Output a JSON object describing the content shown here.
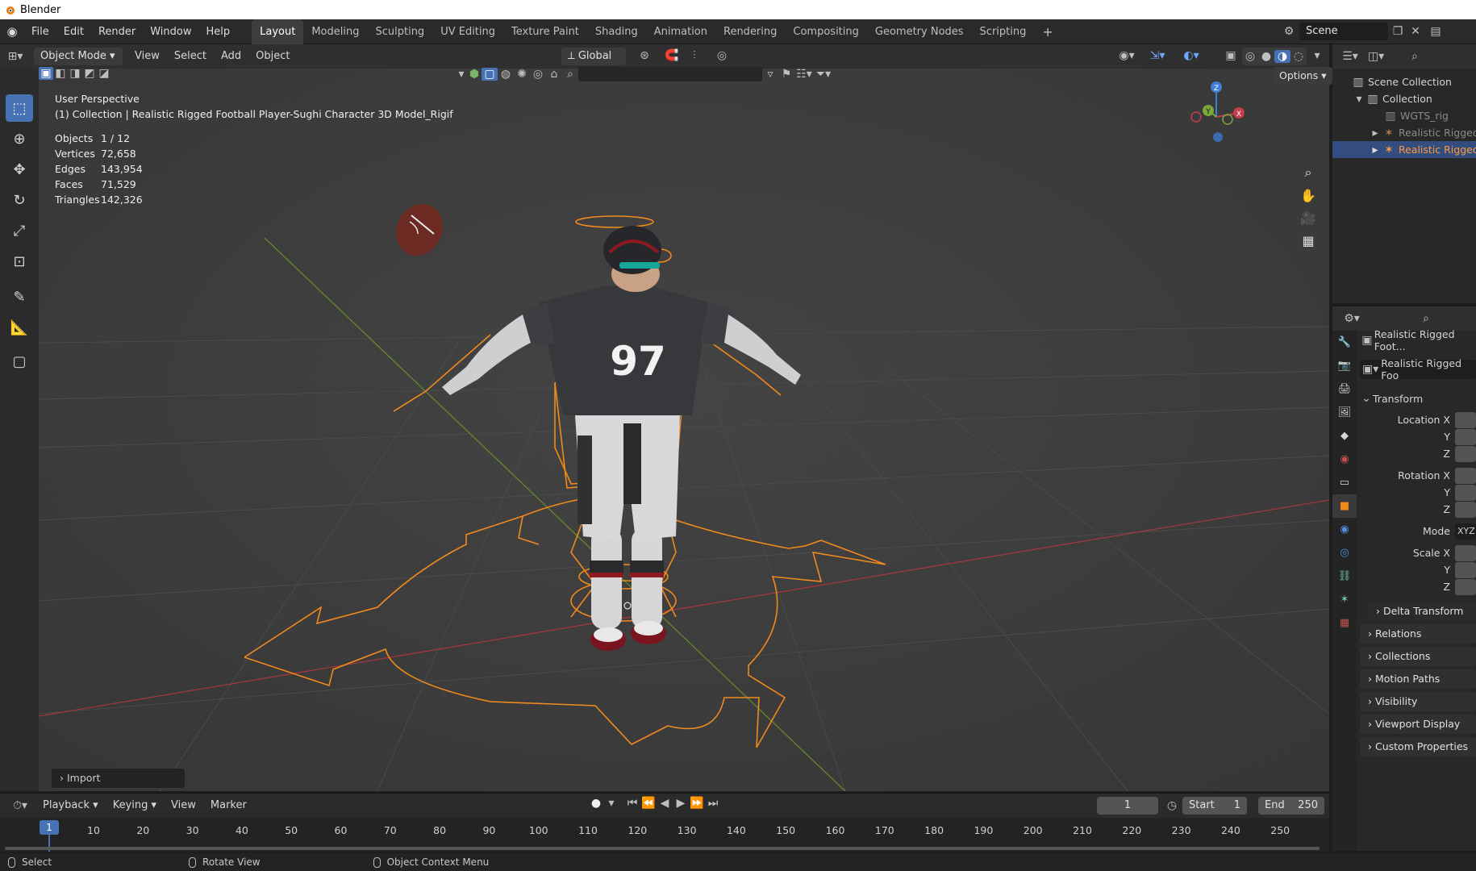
{
  "app": {
    "title": "Blender"
  },
  "topbar": {
    "menus": [
      "File",
      "Edit",
      "Render",
      "Window",
      "Help"
    ],
    "workspaces": [
      "Layout",
      "Modeling",
      "Sculpting",
      "UV Editing",
      "Texture Paint",
      "Shading",
      "Animation",
      "Rendering",
      "Compositing",
      "Geometry Nodes",
      "Scripting"
    ],
    "active_workspace": "Layout",
    "scene_name": "Scene",
    "add_tab_icon": "plus-icon"
  },
  "viewport_header": {
    "mode": "Object Mode",
    "menus": [
      "View",
      "Select",
      "Add",
      "Object"
    ],
    "orientation": "Global",
    "options_label": "Options"
  },
  "viewport": {
    "perspective": "User Perspective",
    "collection_line": "(1) Collection | Realistic Rigged Football Player-Sughi Character 3D Model_Rigif",
    "stats": [
      {
        "k": "Objects",
        "v": "1 / 12"
      },
      {
        "k": "Vertices",
        "v": "72,658"
      },
      {
        "k": "Edges",
        "v": "143,954"
      },
      {
        "k": "Faces",
        "v": "71,529"
      },
      {
        "k": "Triangles",
        "v": "142,326"
      }
    ],
    "jersey_number": "97",
    "import_panel": "Import",
    "gizmo": {
      "x": "X",
      "y": "Y",
      "z": "Z"
    }
  },
  "outliner": {
    "rows": [
      {
        "label": "Scene Collection",
        "indent": 0,
        "icon": "scene-collection-icon"
      },
      {
        "label": "Collection",
        "indent": 1,
        "icon": "collection-icon"
      },
      {
        "label": "WGTS_rig",
        "indent": 2,
        "icon": "collection-icon"
      },
      {
        "label": "Realistic Rigged F",
        "indent": 2,
        "icon": "armature-icon"
      },
      {
        "label": "Realistic Rigged F",
        "indent": 2,
        "icon": "armature-icon",
        "selected": true
      }
    ]
  },
  "properties": {
    "object_name": "Realistic Rigged Foot...",
    "data_name": "Realistic Rigged Foo",
    "transform_label": "Transform",
    "location_x": "Location X",
    "y": "Y",
    "z": "Z",
    "rotation_x": "Rotation X",
    "mode_label": "Mode",
    "mode_value": "XYZ",
    "scale_x": "Scale X",
    "sections": [
      "Delta Transform",
      "Relations",
      "Collections",
      "Motion Paths",
      "Visibility",
      "Viewport Display",
      "Custom Properties"
    ]
  },
  "timeline": {
    "menus": [
      "Playback",
      "Keying",
      "View",
      "Marker"
    ],
    "current_frame": "1",
    "start_label": "Start",
    "start_value": "1",
    "end_label": "End",
    "end_value": "250",
    "frame_labels": [
      "10",
      "20",
      "30",
      "40",
      "50",
      "60",
      "70",
      "80",
      "90",
      "100",
      "110",
      "120",
      "130",
      "140",
      "150",
      "160",
      "170",
      "180",
      "190",
      "200",
      "210",
      "220",
      "230",
      "240",
      "250"
    ]
  },
  "statusbar": {
    "items": [
      "Select",
      "Rotate View",
      "Object Context Menu"
    ]
  },
  "colors": {
    "accent": "#4772b3",
    "rig": "#f08a1d",
    "x_axis": "#c23e4a",
    "y_axis": "#7aa83a",
    "z_axis": "#3d7fd6"
  }
}
